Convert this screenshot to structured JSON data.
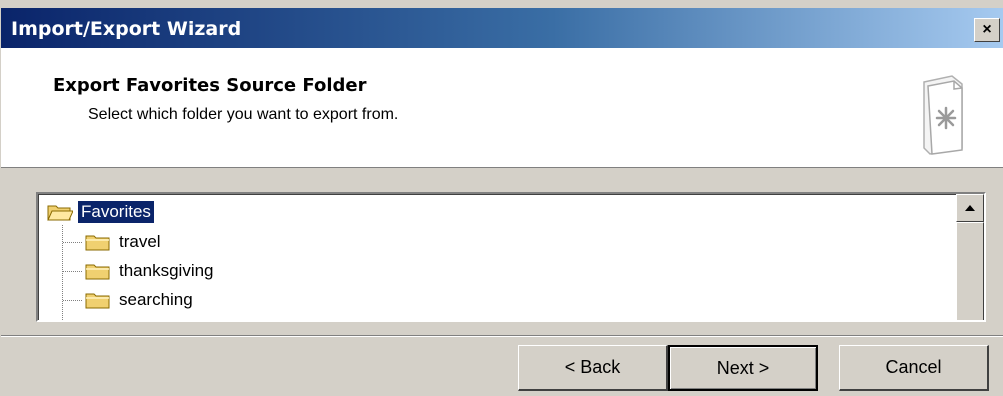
{
  "window": {
    "title": "Import/Export Wizard",
    "close_label": "×",
    "title_gradient": [
      "#0a246a",
      "#a6caf0"
    ]
  },
  "header": {
    "title": "Export Favorites Source Folder",
    "subtitle": "Select which folder you want to export from.",
    "icon": "wizard-document-icon"
  },
  "tree": {
    "items": [
      {
        "label": "Favorites",
        "selected": true,
        "icon": "folder-open-icon"
      },
      {
        "label": "travel",
        "selected": false,
        "icon": "folder-icon"
      },
      {
        "label": "thanksgiving",
        "selected": false,
        "icon": "folder-icon"
      },
      {
        "label": "searching",
        "selected": false,
        "icon": "folder-icon"
      }
    ],
    "selection_color": "#0a246a"
  },
  "buttons": {
    "back_label": "< Back",
    "next_label": "Next >",
    "cancel_label": "Cancel"
  }
}
